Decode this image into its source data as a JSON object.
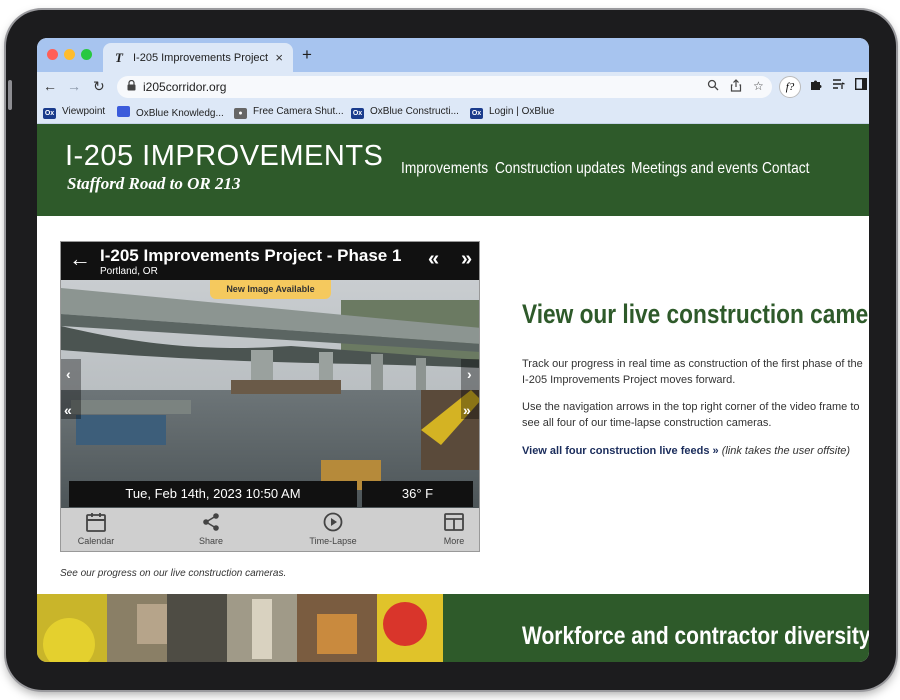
{
  "browser": {
    "tab_favicon": "T",
    "tab_title": "I-205 Improvements Project",
    "tab_close": "×",
    "new_tab": "+",
    "url": "i205corridor.org",
    "extension_label": "f?",
    "bookmarks": [
      {
        "label": "Viewpoint",
        "icon": "Ox",
        "color": "#1a3b8c"
      },
      {
        "label": "OxBlue Knowledg...",
        "icon": "",
        "color": "#3b5bdb"
      },
      {
        "label": "Free Camera Shut...",
        "icon": "camera-icon",
        "color": "#666666"
      },
      {
        "label": "OxBlue Constructi...",
        "icon": "Ox",
        "color": "#1a3b8c"
      },
      {
        "label": "Login | OxBlue",
        "icon": "Ox",
        "color": "#1a3b8c"
      }
    ]
  },
  "site": {
    "logo_main": "I-205 IMPROVEMENTS",
    "logo_sub": "Stafford Road to OR 213",
    "nav": [
      "Improvements",
      "Construction updates",
      "Meetings and events",
      "Contact"
    ],
    "brand_color": "#2e5a2a"
  },
  "camera": {
    "title": "I-205 Improvements Project - Phase 1",
    "location": "Portland, OR",
    "new_image": "New Image Available",
    "datetime": "Tue, Feb 14th, 2023 10:50 AM",
    "temperature": "36° F",
    "buttons": [
      "Calendar",
      "Share",
      "Time-Lapse",
      "More"
    ]
  },
  "content": {
    "caption": "See our progress on our live construction cameras.",
    "heading": "View our live construction cameras!",
    "para1": "Track our progress in real time as construction of the first phase of the I-205 Improvements Project moves forward.",
    "para2": "Use the navigation arrows in the top right corner of the video frame to see all four of our time-lapse construction cameras.",
    "feed_link": "View all four construction live feeds »",
    "feed_note": " (link takes the user offsite)"
  },
  "bottom": {
    "heading": "Workforce and contractor diversity"
  }
}
